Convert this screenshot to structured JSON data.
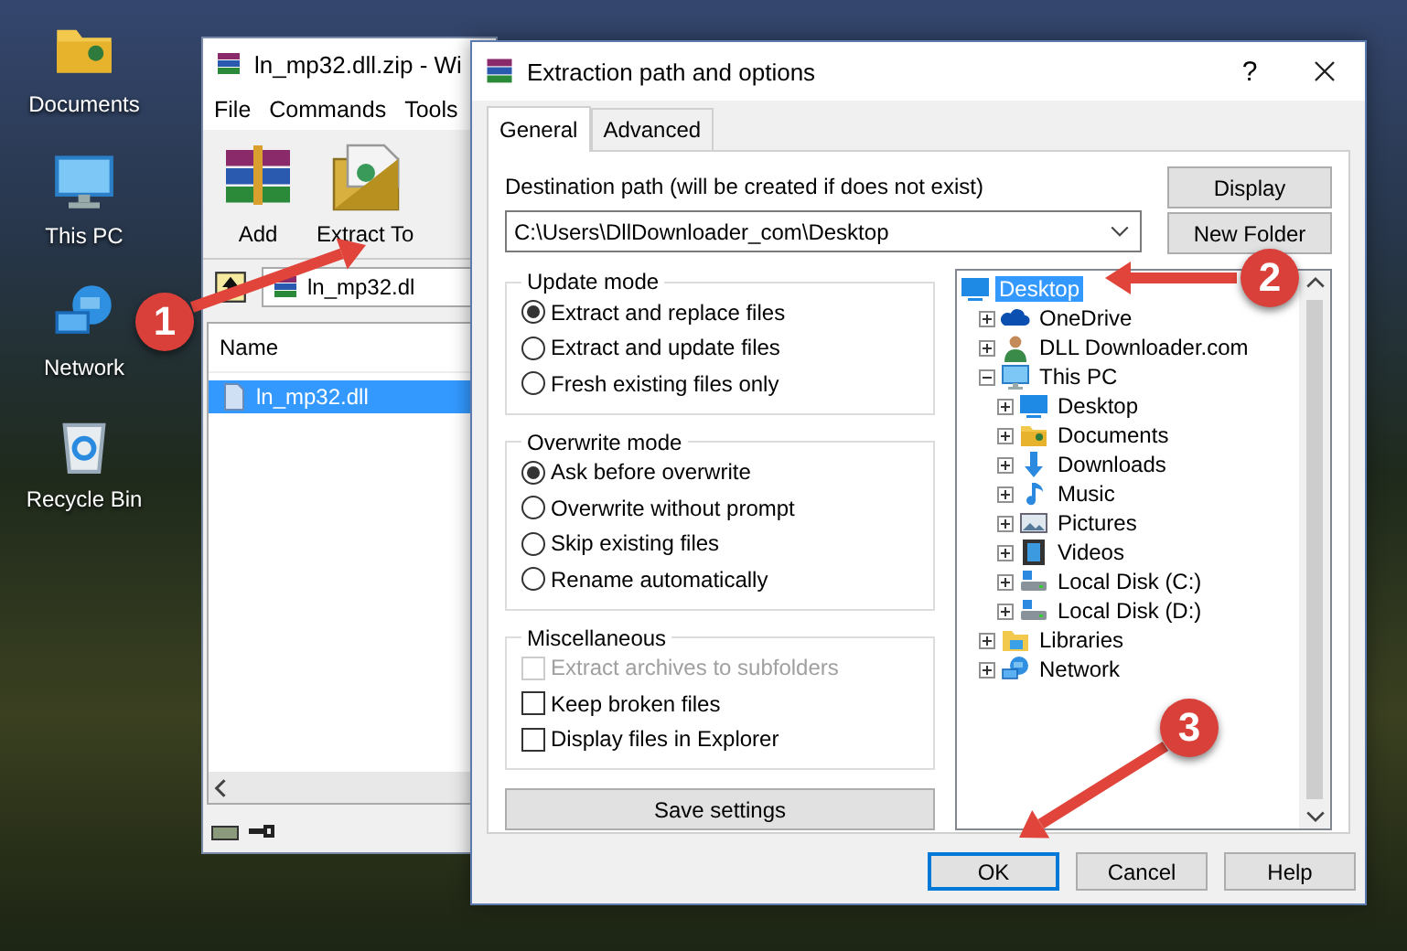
{
  "desktop_icons": [
    {
      "label": "Documents",
      "kind": "documents"
    },
    {
      "label": "This PC",
      "kind": "pc"
    },
    {
      "label": "Network",
      "kind": "network"
    },
    {
      "label": "Recycle Bin",
      "kind": "recycle"
    }
  ],
  "archive_window": {
    "title": "ln_mp32.dll.zip - Wi",
    "menu": [
      "File",
      "Commands",
      "Tools"
    ],
    "toolbar": [
      {
        "label": "Add",
        "kind": "add"
      },
      {
        "label": "Extract To",
        "kind": "extract"
      }
    ],
    "address": "ln_mp32.dl",
    "columns": [
      "Name"
    ],
    "files": [
      {
        "name": "ln_mp32.dll",
        "selected": true
      }
    ]
  },
  "dialog": {
    "title": "Extraction path and options",
    "help": "?",
    "tabs": [
      {
        "label": "General",
        "selected": true
      },
      {
        "label": "Advanced",
        "selected": false
      }
    ],
    "destination": {
      "label": "Destination path (will be created if does not exist)",
      "value": "C:\\Users\\DllDownloader_com\\Desktop"
    },
    "side_buttons": [
      "Display",
      "New Folder"
    ],
    "groups": [
      {
        "title": "Update mode",
        "options": [
          {
            "label": "Extract and replace files",
            "kind": "radio",
            "selected": true
          },
          {
            "label": "Extract and update files",
            "kind": "radio",
            "selected": false
          },
          {
            "label": "Fresh existing files only",
            "kind": "radio",
            "selected": false
          }
        ]
      },
      {
        "title": "Overwrite mode",
        "options": [
          {
            "label": "Ask before overwrite",
            "kind": "radio",
            "selected": true
          },
          {
            "label": "Overwrite without prompt",
            "kind": "radio",
            "selected": false
          },
          {
            "label": "Skip existing files",
            "kind": "radio",
            "selected": false
          },
          {
            "label": "Rename automatically",
            "kind": "radio",
            "selected": false
          }
        ]
      },
      {
        "title": "Miscellaneous",
        "options": [
          {
            "label": "Extract archives to subfolders",
            "kind": "checkbox",
            "checked": false,
            "disabled": true
          },
          {
            "label": "Keep broken files",
            "kind": "checkbox",
            "checked": false,
            "disabled": false
          },
          {
            "label": "Display files in Explorer",
            "kind": "checkbox",
            "checked": false,
            "disabled": false
          }
        ]
      }
    ],
    "save_button": "Save settings",
    "tree": [
      {
        "label": "Desktop",
        "kind": "desktop",
        "selected": true,
        "children": [
          {
            "label": "OneDrive",
            "kind": "cloud",
            "expanded": false,
            "selected": false
          },
          {
            "label": "DLL Downloader.com",
            "kind": "user",
            "expanded": false,
            "selected": false
          },
          {
            "label": "This PC",
            "kind": "pc",
            "expanded": true,
            "selected": false,
            "children": [
              {
                "label": "Desktop",
                "kind": "desktop",
                "expanded": false,
                "selected": false
              },
              {
                "label": "Documents",
                "kind": "documents",
                "expanded": false,
                "selected": false
              },
              {
                "label": "Downloads",
                "kind": "downloads",
                "expanded": false,
                "selected": false
              },
              {
                "label": "Music",
                "kind": "music",
                "expanded": false,
                "selected": false
              },
              {
                "label": "Pictures",
                "kind": "pictures",
                "expanded": false,
                "selected": false
              },
              {
                "label": "Videos",
                "kind": "videos",
                "expanded": false,
                "selected": false
              },
              {
                "label": "Local Disk (C:)",
                "kind": "drive",
                "expanded": false,
                "selected": false
              },
              {
                "label": "Local Disk (D:)",
                "kind": "drive",
                "expanded": false,
                "selected": false
              }
            ]
          },
          {
            "label": "Libraries",
            "kind": "library",
            "expanded": false,
            "selected": false
          },
          {
            "label": "Network",
            "kind": "network",
            "expanded": false,
            "selected": false
          }
        ]
      }
    ],
    "buttons": [
      {
        "label": "OK",
        "default": true
      },
      {
        "label": "Cancel",
        "default": false
      },
      {
        "label": "Help",
        "default": false
      }
    ]
  },
  "annotations": [
    {
      "number": "1"
    },
    {
      "number": "2"
    },
    {
      "number": "3"
    }
  ]
}
